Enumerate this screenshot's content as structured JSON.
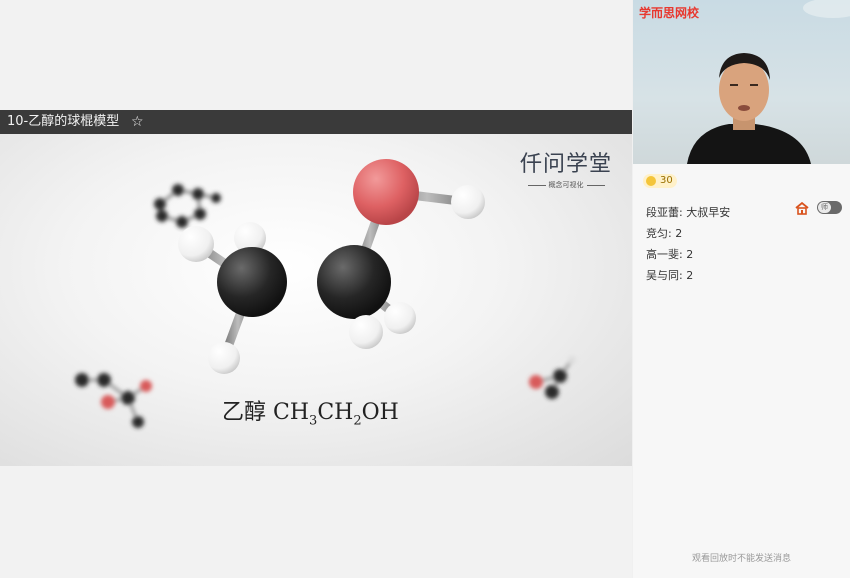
{
  "lesson": {
    "title": "10-乙醇的球棍模型",
    "star_icon": "star-icon"
  },
  "slide": {
    "brand_name": "仟问学堂",
    "brand_tagline": "概念可视化",
    "formula": {
      "name": "乙醇",
      "c1": "CH",
      "sub1": "3",
      "c2": "CH",
      "sub2": "2",
      "tail": "OH"
    },
    "colors": {
      "carbon": "#2a2a2a",
      "oxygen": "#e0666a",
      "hydrogen": "#ffffff"
    }
  },
  "side_panel": {
    "logo": "学而思网校",
    "coins": "30",
    "messages": [
      {
        "text": "段亚蕾: 大叔早安"
      },
      {
        "text": "竞匀: 2"
      },
      {
        "text": "高一斐: 2"
      },
      {
        "text": "吴与同: 2"
      }
    ],
    "toggle_label": "师",
    "footer": "观看回放时不能发送消息"
  },
  "accent_color": "#e8382f"
}
